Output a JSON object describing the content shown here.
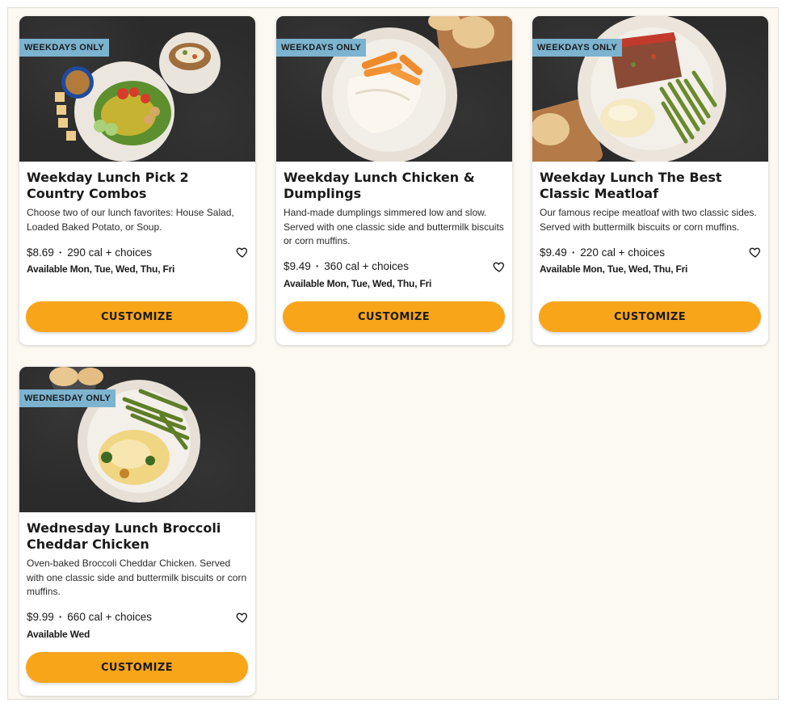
{
  "colors": {
    "accent_button": "#f9a51a",
    "badge": "#7cb3cf",
    "page_background": "#fcf8f2"
  },
  "cards": [
    {
      "badge": "WEEKDAYS ONLY",
      "title": "Weekday Lunch Pick 2 Country Combos",
      "description": "Choose two of our lunch favorites: House Salad, Loaded Baked Potato, or Soup.",
      "price": "$8.69",
      "calories": "290 cal + choices",
      "availability": "Available Mon, Tue, Wed, Thu, Fri",
      "button": "CUSTOMIZE",
      "favorite_icon": "heart-outline-icon"
    },
    {
      "badge": "WEEKDAYS ONLY",
      "title": "Weekday Lunch Chicken & Dumplings",
      "description": "Hand-made dumplings simmered low and slow. Served with one classic side and buttermilk biscuits or corn muffins.",
      "price": "$9.49",
      "calories": "360 cal + choices",
      "availability": "Available Mon, Tue, Wed, Thu, Fri",
      "button": "CUSTOMIZE",
      "favorite_icon": "heart-outline-icon"
    },
    {
      "badge": "WEEKDAYS ONLY",
      "title": "Weekday Lunch The Best Classic Meatloaf",
      "description": "Our famous recipe meatloaf with two classic sides. Served with buttermilk biscuits or corn muffins.",
      "price": "$9.49",
      "calories": "220 cal + choices",
      "availability": "Available Mon, Tue, Wed, Thu, Fri",
      "button": "CUSTOMIZE",
      "favorite_icon": "heart-outline-icon"
    },
    {
      "badge": "WEDNESDAY ONLY",
      "title": "Wednesday Lunch Broccoli Cheddar Chicken",
      "description": "Oven-baked Broccoli Cheddar Chicken. Served with one classic side and buttermilk biscuits or corn muffins.",
      "price": "$9.99",
      "calories": "660 cal + choices",
      "availability": "Available Wed",
      "button": "CUSTOMIZE",
      "favorite_icon": "heart-outline-icon"
    }
  ]
}
